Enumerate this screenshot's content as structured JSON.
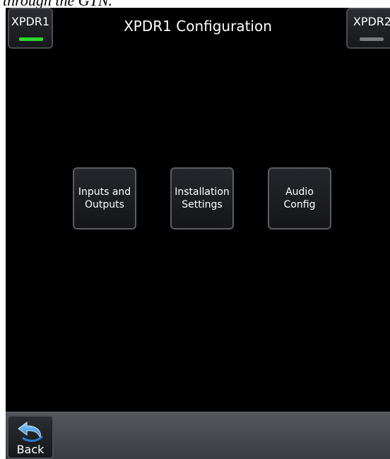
{
  "caption": "through the GTN.",
  "title": "XPDR1 Configuration",
  "xpdr1": {
    "label": "XPDR1",
    "indicator_color": "#2fd62f"
  },
  "xpdr2": {
    "label": "XPDR2",
    "indicator_color": "#7a7c80"
  },
  "config_buttons": [
    {
      "label": "Inputs and\nOutputs"
    },
    {
      "label": "Installation\nSettings"
    },
    {
      "label": "Audio\nConfig"
    }
  ],
  "back": {
    "label": "Back",
    "icon": "back-arrow-icon"
  }
}
